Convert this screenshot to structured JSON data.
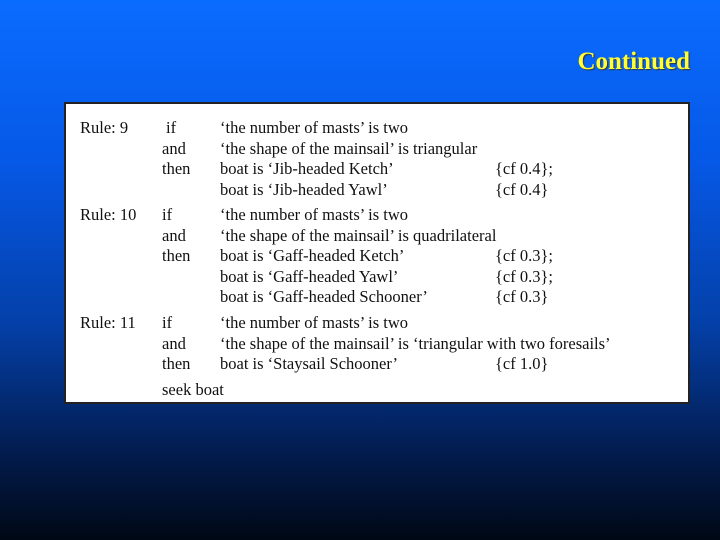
{
  "title": "Continued",
  "rules": [
    {
      "label": "Rule: 9",
      "lines": [
        {
          "kw": "if",
          "text": "‘the number of masts’ is two",
          "cf": ""
        },
        {
          "kw": "and",
          "text": "‘the shape of the mainsail’ is triangular",
          "cf": ""
        },
        {
          "kw": "then",
          "text": "boat is ‘Jib-headed Ketch’",
          "cf": "{cf 0.4};"
        },
        {
          "kw": "",
          "text": "boat is ‘Jib-headed Yawl’",
          "cf": "{cf 0.4}"
        }
      ]
    },
    {
      "label": "Rule: 10",
      "lines": [
        {
          "kw": "if",
          "text": "‘the number of masts’ is two",
          "cf": ""
        },
        {
          "kw": "and",
          "text": "‘the shape of the mainsail’ is quadrilateral",
          "cf": ""
        },
        {
          "kw": "then",
          "text": "boat is ‘Gaff-headed Ketch’",
          "cf": "{cf 0.3};"
        },
        {
          "kw": "",
          "text": "boat is ‘Gaff-headed Yawl’",
          "cf": "{cf 0.3};"
        },
        {
          "kw": "",
          "text": "boat is ‘Gaff-headed Schooner’",
          "cf": "{cf 0.3}"
        }
      ]
    },
    {
      "label": "Rule: 11",
      "lines": [
        {
          "kw": "if",
          "text": "‘the number of masts’ is two",
          "cf": ""
        },
        {
          "kw": "and",
          "text": "‘the shape of the mainsail’ is ‘triangular with two foresails’",
          "cf": ""
        },
        {
          "kw": "then",
          "text": "boat is ‘Staysail Schooner’",
          "cf": "{cf 1.0}"
        }
      ]
    }
  ],
  "footer": "seek boat"
}
